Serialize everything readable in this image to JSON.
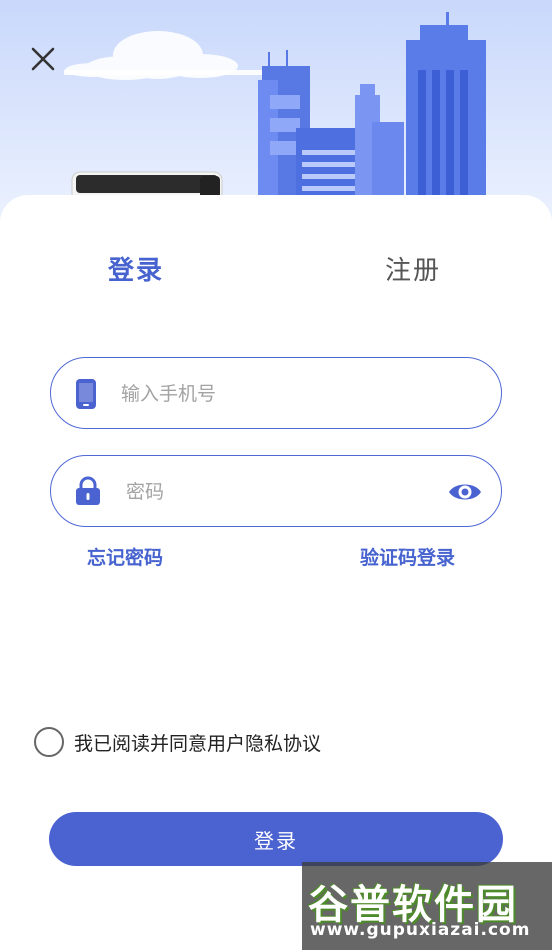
{
  "header": {
    "close_icon": "close-icon",
    "scene": "city-skyline-with-bus"
  },
  "tabs": [
    {
      "label": "登录",
      "active": true
    },
    {
      "label": "注册",
      "active": false
    }
  ],
  "form": {
    "phone": {
      "placeholder": "输入手机号",
      "value": "",
      "icon": "phone-icon"
    },
    "password": {
      "placeholder": "密码",
      "value": "",
      "icon": "lock-icon",
      "toggle_icon": "eye-icon"
    }
  },
  "links": {
    "forgot": "忘记密码",
    "code_login": "验证码登录"
  },
  "agreement": {
    "text": "我已阅读并同意用户隐私协议",
    "checked": false
  },
  "submit_label": "登录",
  "watermark": {
    "title": "谷普软件园",
    "url": "www.gupuxiazai.com"
  },
  "colors": {
    "accent": "#4b62d1",
    "header_bg": "#c9d8fb"
  }
}
